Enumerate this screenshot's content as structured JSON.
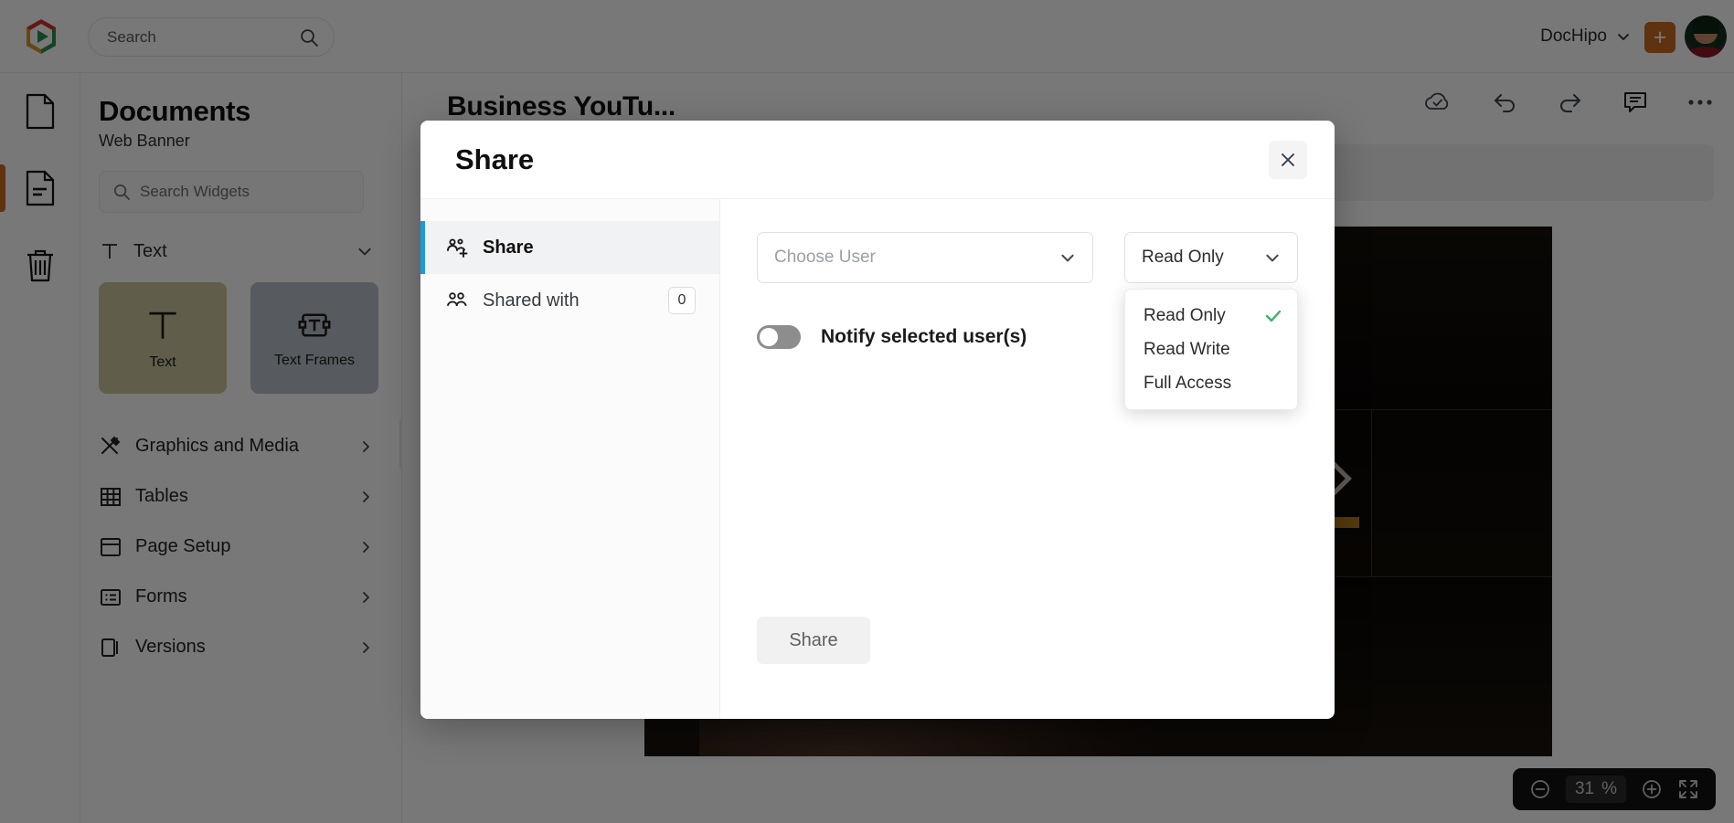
{
  "topbar": {
    "search_placeholder": "Search",
    "search_icon": "search-icon",
    "logo_icon": "dochipo-logo-icon",
    "brand_label": "DocHipo",
    "brand_chevron_icon": "chevron-down-icon",
    "add_label": "+",
    "avatar_icon": "user-avatar",
    "accent_orange": "#c96a22"
  },
  "rail": {
    "items": [
      {
        "icon": "blank-document-icon",
        "name": "documents"
      },
      {
        "icon": "document-lines-icon",
        "name": "templates"
      },
      {
        "icon": "trash-icon",
        "name": "trash"
      }
    ]
  },
  "panel": {
    "title": "Documents",
    "subtitle": "Web Banner",
    "search_placeholder": "Search Widgets",
    "search_icon": "search-icon",
    "text_section": {
      "label": "Text",
      "icon": "text-t-icon",
      "chevron": "chevron-down-icon",
      "cards": [
        {
          "label": "Text",
          "icon": "text-t-icon"
        },
        {
          "label": "Text Frames",
          "icon": "text-frame-icon"
        }
      ]
    },
    "nav_items": [
      {
        "label": "Graphics and Media",
        "icon": "graphics-media-icon",
        "chevron": "chevron-right-icon"
      },
      {
        "label": "Tables",
        "icon": "table-grid-icon",
        "chevron": "chevron-right-icon"
      },
      {
        "label": "Page Setup",
        "icon": "page-setup-icon",
        "chevron": "chevron-right-icon"
      },
      {
        "label": "Forms",
        "icon": "forms-icon",
        "chevron": "chevron-right-icon"
      },
      {
        "label": "Versions",
        "icon": "versions-icon",
        "chevron": "chevron-right-icon"
      }
    ],
    "collapse_icon": "chevron-left-icon"
  },
  "editor": {
    "doc_title": "Business YouTu...",
    "toolbar_icons": [
      "cloud-saved-icon",
      "undo-icon",
      "redo-icon",
      "comment-icon",
      "more-options-icon"
    ],
    "zoom": {
      "minus_icon": "zoom-out-icon",
      "value": "31",
      "unit": "%",
      "plus_icon": "zoom-in-icon",
      "fullscreen_icon": "fullscreen-icon"
    }
  },
  "modal": {
    "title": "Share",
    "close_icon": "close-icon",
    "tabs": [
      {
        "label": "Share",
        "icon": "person-add-icon",
        "active": true,
        "badge": null
      },
      {
        "label": "Shared with",
        "icon": "people-icon",
        "active": false,
        "badge": "0"
      }
    ],
    "user_select": {
      "placeholder": "Choose User",
      "chevron_icon": "chevron-down-icon"
    },
    "permission_select": {
      "value": "Read Only",
      "chevron_icon": "chevron-down-icon",
      "open": true,
      "check_icon": "check-icon",
      "check_color": "#3fb36b",
      "options": [
        {
          "label": "Read Only",
          "selected": true
        },
        {
          "label": "Read Write",
          "selected": false
        },
        {
          "label": "Full Access",
          "selected": false
        }
      ]
    },
    "notify": {
      "label": "Notify selected user(s)",
      "on": false
    },
    "submit_label": "Share",
    "active_tab_color": "#1b9ae0"
  }
}
